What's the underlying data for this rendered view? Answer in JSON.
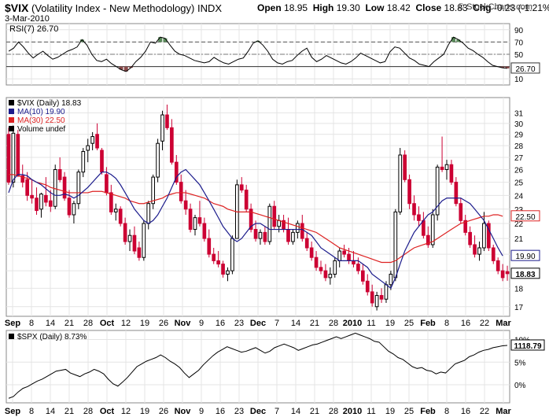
{
  "header": {
    "symbol": "$VIX",
    "name": "(Volatility Index - New Methodology)",
    "exchange": "INDX",
    "date": "3-Mar-2010",
    "open_label": "Open",
    "open": "18.95",
    "high_label": "High",
    "high": "19.30",
    "low_label": "Low",
    "low": "18.42",
    "close_label": "Close",
    "close": "18.83",
    "chg_label": "Chg",
    "chg": "-0.23 (-1.21%)",
    "credit": "© StockCharts.com"
  },
  "colors": {
    "up": "#000000",
    "down": "#cc0033",
    "ma10": "#1c1c8c",
    "ma30": "#dd2222",
    "rsi_up_fill": "#5a8a5a",
    "rsi_down_fill": "#8a4a4a"
  },
  "x_axis": {
    "labels": [
      "Sep",
      "8",
      "14",
      "21",
      "28",
      "Oct",
      "12",
      "19",
      "26",
      "Nov",
      "9",
      "16",
      "23",
      "Dec",
      "7",
      "14",
      "21",
      "28",
      "2010",
      "11",
      "19",
      "25",
      "Feb",
      "8",
      "16",
      "22",
      "Mar"
    ]
  },
  "chart_data": [
    {
      "type": "line",
      "title": "RSI(7) 26.70",
      "legend": [
        "RSI(7) 26.70"
      ],
      "y_ticks": [
        10,
        30,
        50,
        70,
        90
      ],
      "ylim": [
        0,
        100
      ],
      "overbought": 70,
      "oversold": 30,
      "last_value_label": "26.70",
      "values": [
        55,
        60,
        70,
        62,
        52,
        44,
        50,
        55,
        48,
        42,
        45,
        50,
        55,
        58,
        62,
        74,
        65,
        50,
        40,
        38,
        42,
        35,
        30,
        25,
        22,
        28,
        38,
        45,
        55,
        70,
        68,
        78,
        76,
        65,
        55,
        50,
        48,
        44,
        40,
        38,
        36,
        38,
        45,
        40,
        36,
        34,
        38,
        42,
        44,
        55,
        68,
        72,
        65,
        55,
        42,
        36,
        34,
        38,
        40,
        48,
        55,
        60,
        45,
        38,
        42,
        48,
        44,
        40,
        36,
        34,
        38,
        44,
        52,
        48,
        44,
        40,
        36,
        38,
        54,
        62,
        60,
        52,
        44,
        40,
        34,
        32,
        30,
        38,
        44,
        50,
        66,
        78,
        74,
        68,
        60,
        56,
        50,
        45,
        38,
        32,
        30,
        28,
        27
      ]
    },
    {
      "type": "candlestick",
      "title": "$VIX (Daily) 18.83",
      "legend": [
        "$VIX (Daily) 18.83",
        "MA(10) 19.90",
        "MA(30) 22.50",
        "Volume undef"
      ],
      "y_scale": "log",
      "y_ticks": [
        17,
        18,
        19,
        20,
        21,
        22,
        23,
        24,
        25,
        26,
        27,
        28,
        29,
        30,
        31
      ],
      "ylim": [
        16.5,
        32.5
      ],
      "ohlc": [
        [
          29.0,
          29.6,
          24.8,
          25.0
        ],
        [
          25.0,
          29.8,
          24.6,
          29.1
        ],
        [
          29.0,
          29.4,
          25.4,
          25.5
        ],
        [
          25.5,
          26.4,
          24.6,
          25.0
        ],
        [
          25.2,
          25.8,
          23.6,
          24.0
        ],
        [
          24.0,
          25.2,
          23.4,
          23.8
        ],
        [
          23.8,
          24.6,
          22.6,
          22.9
        ],
        [
          23.0,
          24.2,
          22.4,
          24.1
        ],
        [
          24.0,
          25.4,
          23.2,
          23.5
        ],
        [
          23.6,
          24.4,
          22.8,
          23.2
        ],
        [
          23.2,
          26.4,
          23.0,
          26.0
        ],
        [
          26.0,
          27.0,
          25.0,
          25.2
        ],
        [
          25.4,
          25.8,
          23.6,
          23.8
        ],
        [
          23.8,
          24.4,
          22.4,
          22.6
        ],
        [
          22.6,
          23.6,
          22.0,
          23.4
        ],
        [
          23.4,
          26.0,
          23.0,
          25.8
        ],
        [
          25.8,
          27.8,
          25.4,
          27.5
        ],
        [
          27.6,
          28.6,
          26.6,
          28.0
        ],
        [
          28.2,
          29.2,
          27.6,
          28.8
        ],
        [
          29.0,
          30.0,
          27.6,
          27.8
        ],
        [
          27.6,
          27.8,
          25.6,
          25.8
        ],
        [
          25.6,
          26.2,
          24.0,
          24.2
        ],
        [
          24.2,
          24.8,
          22.6,
          22.8
        ],
        [
          22.8,
          23.4,
          22.2,
          23.0
        ],
        [
          23.0,
          23.2,
          21.8,
          22.0
        ],
        [
          22.0,
          22.4,
          20.6,
          20.8
        ],
        [
          20.8,
          21.6,
          20.2,
          21.2
        ],
        [
          21.2,
          21.8,
          20.0,
          20.2
        ],
        [
          20.4,
          20.8,
          19.6,
          19.8
        ],
        [
          19.8,
          22.2,
          19.6,
          22.0
        ],
        [
          22.0,
          23.6,
          21.6,
          23.4
        ],
        [
          23.4,
          25.6,
          23.0,
          25.4
        ],
        [
          25.4,
          28.6,
          25.0,
          28.2
        ],
        [
          28.4,
          31.2,
          27.6,
          30.8
        ],
        [
          30.8,
          31.8,
          29.4,
          29.6
        ],
        [
          29.6,
          30.4,
          26.4,
          26.6
        ],
        [
          26.6,
          27.2,
          24.8,
          25.0
        ],
        [
          25.0,
          25.6,
          23.4,
          23.6
        ],
        [
          23.6,
          24.4,
          22.6,
          23.0
        ],
        [
          23.0,
          23.4,
          21.4,
          21.6
        ],
        [
          21.6,
          22.6,
          21.2,
          22.4
        ],
        [
          22.4,
          23.6,
          21.8,
          22.0
        ],
        [
          22.0,
          22.4,
          20.8,
          21.0
        ],
        [
          21.0,
          21.6,
          19.8,
          20.0
        ],
        [
          20.0,
          20.4,
          19.4,
          19.6
        ],
        [
          19.6,
          20.2,
          19.2,
          19.4
        ],
        [
          19.4,
          19.6,
          18.6,
          18.8
        ],
        [
          18.8,
          19.2,
          18.4,
          19.0
        ],
        [
          19.0,
          21.2,
          18.8,
          21.0
        ],
        [
          21.0,
          25.2,
          21.0,
          24.8
        ],
        [
          24.8,
          25.4,
          24.2,
          24.4
        ],
        [
          24.4,
          24.8,
          22.8,
          23.0
        ],
        [
          23.0,
          23.4,
          21.4,
          21.6
        ],
        [
          21.6,
          22.2,
          20.8,
          21.0
        ],
        [
          21.0,
          21.6,
          20.6,
          21.4
        ],
        [
          21.4,
          21.8,
          20.6,
          20.8
        ],
        [
          20.8,
          23.4,
          20.6,
          23.2
        ],
        [
          23.2,
          23.6,
          21.6,
          21.8
        ],
        [
          21.8,
          22.6,
          21.4,
          22.2
        ],
        [
          22.2,
          22.6,
          21.4,
          21.6
        ],
        [
          21.6,
          22.4,
          20.6,
          20.8
        ],
        [
          20.8,
          21.6,
          20.6,
          21.4
        ],
        [
          21.4,
          22.2,
          21.0,
          22.0
        ],
        [
          22.0,
          22.6,
          20.8,
          21.0
        ],
        [
          21.0,
          21.4,
          20.2,
          20.4
        ],
        [
          20.4,
          20.8,
          19.6,
          19.8
        ],
        [
          19.8,
          20.2,
          19.0,
          19.2
        ],
        [
          19.2,
          19.6,
          18.8,
          19.0
        ],
        [
          19.0,
          19.4,
          18.4,
          18.6
        ],
        [
          18.6,
          19.2,
          18.2,
          18.8
        ],
        [
          18.8,
          19.8,
          18.6,
          19.6
        ],
        [
          19.6,
          20.4,
          19.2,
          20.2
        ],
        [
          20.2,
          20.6,
          19.8,
          20.0
        ],
        [
          20.0,
          20.4,
          19.4,
          19.6
        ],
        [
          19.6,
          20.2,
          19.2,
          19.4
        ],
        [
          19.4,
          19.8,
          18.8,
          19.0
        ],
        [
          19.0,
          19.4,
          18.2,
          18.4
        ],
        [
          18.4,
          18.8,
          17.6,
          17.8
        ],
        [
          17.8,
          18.2,
          17.0,
          17.2
        ],
        [
          17.0,
          17.8,
          16.8,
          17.6
        ],
        [
          17.6,
          18.0,
          17.2,
          17.4
        ],
        [
          17.4,
          18.4,
          17.2,
          18.2
        ],
        [
          18.2,
          19.0,
          17.9,
          18.8
        ],
        [
          18.6,
          23.0,
          18.4,
          22.8
        ],
        [
          22.8,
          27.8,
          22.6,
          27.2
        ],
        [
          27.2,
          27.6,
          25.0,
          25.2
        ],
        [
          25.2,
          25.6,
          23.0,
          23.4
        ],
        [
          23.4,
          24.0,
          22.2,
          22.6
        ],
        [
          22.6,
          23.2,
          21.8,
          22.2
        ],
        [
          22.2,
          22.8,
          21.0,
          21.2
        ],
        [
          21.2,
          21.8,
          20.4,
          20.6
        ],
        [
          20.6,
          23.0,
          20.4,
          22.6
        ],
        [
          22.6,
          26.4,
          22.2,
          26.2
        ],
        [
          26.2,
          28.8,
          25.8,
          26.0
        ],
        [
          26.0,
          26.8,
          25.2,
          26.4
        ],
        [
          26.4,
          26.8,
          24.8,
          25.0
        ],
        [
          25.0,
          25.4,
          23.2,
          23.4
        ],
        [
          23.4,
          23.8,
          22.0,
          22.2
        ],
        [
          22.2,
          22.6,
          21.2,
          21.4
        ],
        [
          21.4,
          21.8,
          20.4,
          20.6
        ],
        [
          20.6,
          21.2,
          19.8,
          20.0
        ],
        [
          20.0,
          20.8,
          19.6,
          20.4
        ],
        [
          20.4,
          22.8,
          20.2,
          22.0
        ],
        [
          22.0,
          22.2,
          20.2,
          20.4
        ],
        [
          20.4,
          20.6,
          19.4,
          19.6
        ],
        [
          19.6,
          19.8,
          18.8,
          19.0
        ],
        [
          19.0,
          19.4,
          18.4,
          18.6
        ],
        [
          18.95,
          19.3,
          18.42,
          18.83
        ]
      ],
      "ma10": {
        "label": "MA(10) 19.90",
        "last_value_label": "19.90",
        "values": [
          24.2,
          25.2,
          25.6,
          25.6,
          25.5,
          25.2,
          25.0,
          24.8,
          24.5,
          24.2,
          24.0,
          24.0,
          24.1,
          24.0,
          23.8,
          24.0,
          24.3,
          24.6,
          25.0,
          25.4,
          25.8,
          25.8,
          25.6,
          25.3,
          24.8,
          24.2,
          23.6,
          23.0,
          22.6,
          22.2,
          22.0,
          22.2,
          22.6,
          23.2,
          23.8,
          24.6,
          25.4,
          25.8,
          26.0,
          25.6,
          25.2,
          24.8,
          24.2,
          23.6,
          23.0,
          22.4,
          21.8,
          21.4,
          21.0,
          20.8,
          21.0,
          21.4,
          21.8,
          22.0,
          22.0,
          21.8,
          21.6,
          21.6,
          21.6,
          21.6,
          21.6,
          21.6,
          21.6,
          21.6,
          21.4,
          21.2,
          20.8,
          20.4,
          20.2,
          20.0,
          19.8,
          19.6,
          19.6,
          19.6,
          19.6,
          19.6,
          19.4,
          19.2,
          18.8,
          18.6,
          18.4,
          18.2,
          18.0,
          18.6,
          19.4,
          20.2,
          20.8,
          21.4,
          21.8,
          22.2,
          22.6,
          22.8,
          23.2,
          23.6,
          23.8,
          23.8,
          23.8,
          23.8,
          23.6,
          23.4,
          23.0,
          22.6,
          22.2,
          21.6,
          21.0,
          20.4,
          19.9
        ]
      },
      "ma30": {
        "label": "MA(30) 22.50",
        "last_value_label": "22.50",
        "values": [
          25.6,
          25.6,
          25.5,
          25.4,
          25.3,
          25.2,
          25.0,
          24.9,
          24.8,
          24.6,
          24.5,
          24.4,
          24.3,
          24.2,
          24.2,
          24.2,
          24.2,
          24.2,
          24.3,
          24.3,
          24.3,
          24.2,
          24.1,
          24.0,
          23.9,
          23.8,
          23.6,
          23.5,
          23.4,
          23.4,
          23.5,
          23.6,
          23.7,
          23.8,
          24.0,
          24.1,
          24.2,
          24.2,
          24.2,
          24.1,
          24.0,
          23.9,
          23.8,
          23.6,
          23.4,
          23.3,
          23.2,
          23.0,
          22.9,
          22.8,
          22.8,
          22.8,
          22.8,
          22.7,
          22.6,
          22.5,
          22.4,
          22.3,
          22.2,
          22.1,
          22.0,
          21.9,
          21.8,
          21.7,
          21.6,
          21.5,
          21.4,
          21.2,
          21.0,
          20.8,
          20.6,
          20.4,
          20.3,
          20.2,
          20.1,
          20.0,
          19.9,
          19.8,
          19.7,
          19.6,
          19.5,
          19.5,
          19.5,
          19.6,
          19.8,
          20.0,
          20.2,
          20.4,
          20.5,
          20.6,
          20.7,
          20.8,
          21.0,
          21.2,
          21.4,
          21.6,
          21.8,
          22.0,
          22.1,
          22.2,
          22.3,
          22.4,
          22.5,
          22.5,
          22.6,
          22.6,
          22.5
        ]
      }
    },
    {
      "type": "line",
      "title": "$SPX (Daily) 8.73%",
      "legend": [
        "$SPX (Daily) 8.73%"
      ],
      "y_ticks": [
        "0%",
        "5%",
        "10%"
      ],
      "ylim": [
        -4,
        12
      ],
      "last_value_label": "1118.79",
      "values": [
        -3.0,
        -2.6,
        -1.6,
        -0.8,
        -0.4,
        0.2,
        0.8,
        1.2,
        1.8,
        2.4,
        3.0,
        3.2,
        3.4,
        2.6,
        2.2,
        1.8,
        2.4,
        2.8,
        3.4,
        3.0,
        2.4,
        1.2,
        0.2,
        -0.3,
        0.6,
        1.6,
        2.8,
        4.0,
        4.6,
        5.2,
        5.6,
        6.0,
        6.6,
        6.0,
        5.2,
        4.6,
        3.8,
        2.6,
        1.6,
        2.4,
        3.2,
        4.4,
        5.4,
        6.4,
        7.2,
        7.8,
        8.4,
        8.0,
        7.6,
        7.2,
        7.4,
        7.8,
        8.2,
        7.6,
        7.0,
        7.4,
        8.2,
        8.6,
        9.0,
        8.6,
        8.2,
        7.6,
        8.0,
        8.4,
        8.8,
        9.0,
        9.4,
        9.8,
        10.2,
        10.6,
        10.2,
        10.6,
        11.0,
        11.4,
        11.0,
        10.6,
        10.2,
        9.6,
        9.4,
        8.4,
        7.4,
        6.8,
        6.0,
        5.6,
        4.8,
        4.0,
        3.6,
        3.8,
        3.2,
        3.0,
        2.4,
        2.8,
        2.6,
        3.6,
        4.6,
        5.0,
        5.4,
        6.2,
        6.6,
        7.2,
        7.6,
        7.8,
        8.2,
        8.4,
        8.6,
        8.7
      ]
    }
  ]
}
